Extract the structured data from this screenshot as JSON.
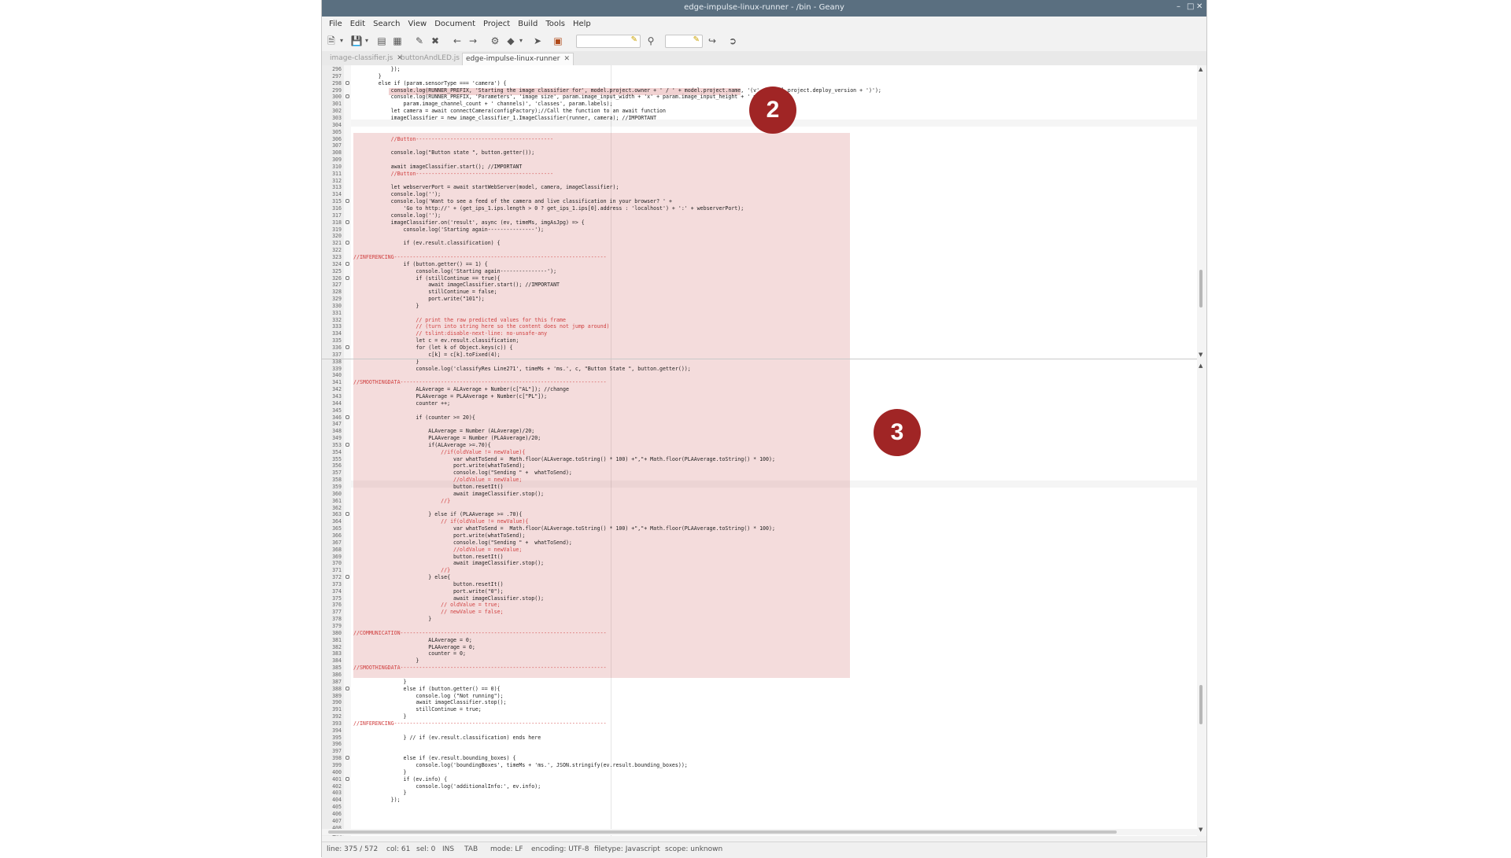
{
  "window": {
    "title": "edge-impulse-linux-runner - /bin - Geany"
  },
  "menu": [
    "File",
    "Edit",
    "Search",
    "View",
    "Document",
    "Project",
    "Build",
    "Tools",
    "Help"
  ],
  "tabs": [
    {
      "label": "image-classifier.js",
      "active": false
    },
    {
      "label": "buttonAndLED.js",
      "active": false
    },
    {
      "label": "edge-impulse-linux-runner",
      "active": true
    }
  ],
  "code_lines": [
    {
      "n": "296",
      "t": "            });"
    },
    {
      "n": "297",
      "t": "        }"
    },
    {
      "n": "298",
      "t": "        else if (param.sensorType === 'camera') {",
      "fold": true
    },
    {
      "n": "299",
      "t": "            console.log(RUNNER_PREFIX, 'Starting the image classifier for', model.project.owner + ' / ' + model.project.name, '(v' + model.project.deploy_version + ')');"
    },
    {
      "n": "300",
      "t": "            console.log(RUNNER_PREFIX, 'Parameters', 'image size', param.image_input_width + 'x' + param.image_input_height + ' px (' +",
      "fold": true
    },
    {
      "n": "301",
      "t": "                param.image_channel_count + ' channels)', 'classes', param.labels);"
    },
    {
      "n": "302",
      "t": "            let camera = await connectCamera(configFactory);//Call the function to an await function"
    },
    {
      "n": "303",
      "t": "            imageClassifier = new image_classifier_1.ImageClassifier(runner, camera); //IMPORTANT"
    },
    {
      "n": "304",
      "t": ""
    },
    {
      "n": "305",
      "t": ""
    },
    {
      "n": "306",
      "t": "            //Button--------------------------------------------",
      "c": true
    },
    {
      "n": "307",
      "t": ""
    },
    {
      "n": "308",
      "t": "            console.log(\"Button state \", button.getter());"
    },
    {
      "n": "309",
      "t": ""
    },
    {
      "n": "310",
      "t": "            await imageClassifier.start(); //IMPORTANT"
    },
    {
      "n": "311",
      "t": "            //Button--------------------------------------------",
      "c": true
    },
    {
      "n": "312",
      "t": ""
    },
    {
      "n": "313",
      "t": "            let webserverPort = await startWebServer(model, camera, imageClassifier);"
    },
    {
      "n": "314",
      "t": "            console.log('');"
    },
    {
      "n": "315",
      "t": "            console.log('Want to see a feed of the camera and live classification in your browser? ' +",
      "fold": true
    },
    {
      "n": "316",
      "t": "                'Go to http://' + (get_ips_1.ips.length > 0 ? get_ips_1.ips[0].address : 'localhost') + ':' + webserverPort);"
    },
    {
      "n": "317",
      "t": "            console.log('');"
    },
    {
      "n": "318",
      "t": "            imageClassifier.on('result', async (ev, timeMs, imgAsJpg) => {",
      "fold": true
    },
    {
      "n": "319",
      "t": "                console.log('Starting again---------------');"
    },
    {
      "n": "320",
      "t": ""
    },
    {
      "n": "321",
      "t": "                if (ev.result.classification) {",
      "fold": true
    },
    {
      "n": "322",
      "t": ""
    },
    {
      "n": "323",
      "t": "//INFERENCING--------------------------------------------------------------------",
      "c": true
    },
    {
      "n": "324",
      "t": "                if (button.getter() == 1) {",
      "fold": true
    },
    {
      "n": "325",
      "t": "                    console.log('Starting again---------------');"
    },
    {
      "n": "326",
      "t": "                    if (stillContinue == true){",
      "fold": true
    },
    {
      "n": "327",
      "t": "                        await imageClassifier.start(); //IMPORTANT"
    },
    {
      "n": "328",
      "t": "                        stillContinue = false;"
    },
    {
      "n": "329",
      "t": "                        port.write(\"101\");"
    },
    {
      "n": "330",
      "t": "                    }"
    },
    {
      "n": "331",
      "t": ""
    },
    {
      "n": "332",
      "t": "                    // print the raw predicted values for this frame",
      "c": true
    },
    {
      "n": "333",
      "t": "                    // (turn into string here so the content does not jump around)",
      "c": true
    },
    {
      "n": "334",
      "t": "                    // tslint:disable-next-line: no-unsafe-any",
      "c": true
    },
    {
      "n": "335",
      "t": "                    let c = ev.result.classification;"
    },
    {
      "n": "336",
      "t": "                    for (let k of Object.keys(c)) {",
      "fold": true
    },
    {
      "n": "337",
      "t": "                        c[k] = c[k].toFixed(4);"
    },
    {
      "n": "338",
      "t": "                    }"
    },
    {
      "n": "339",
      "t": "                    console.log('classifyRes Line271', timeMs + 'ms.', c, \"Button State \", button.getter());"
    },
    {
      "n": "340",
      "t": ""
    },
    {
      "n": "341",
      "t": "//SMOOTHINGDATA------------------------------------------------------------------",
      "c": true
    },
    {
      "n": "342",
      "t": "                    ALAverage = ALAverage + Number(c[\"AL\"]); //change"
    },
    {
      "n": "343",
      "t": "                    PLAAverage = PLAAverage + Number(c[\"PL\"]);"
    },
    {
      "n": "344",
      "t": "                    counter ++;"
    },
    {
      "n": "345",
      "t": ""
    },
    {
      "n": "346",
      "t": "                    if (counter >= 20){",
      "fold": true
    },
    {
      "n": "347",
      "t": ""
    },
    {
      "n": "348",
      "t": "                        ALAverage = Number (ALAverage)/20;"
    },
    {
      "n": "349",
      "t": "                        PLAAverage = Number (PLAAverage)/20;"
    },
    {
      "n": "353",
      "t": "                        if(ALAverage >=.70){",
      "fold": true
    },
    {
      "n": "354",
      "t": "                            //if(oldValue != newValue){",
      "c": true
    },
    {
      "n": "355",
      "t": "                                var whatToSend =  Math.floor(ALAverage.toString() * 100) +\",\"+ Math.floor(PLAAverage.toString() * 100);"
    },
    {
      "n": "356",
      "t": "                                port.write(whatToSend);"
    },
    {
      "n": "357",
      "t": "                                console.log(\"Sending \" +  whatToSend);"
    },
    {
      "n": "358",
      "t": "                                //oldValue = newValue;",
      "c": true
    },
    {
      "n": "359",
      "t": "                                button.resetIt()"
    },
    {
      "n": "360",
      "t": "                                await imageClassifier.stop();"
    },
    {
      "n": "361",
      "t": "                            //}",
      "c": true
    },
    {
      "n": "362",
      "t": ""
    },
    {
      "n": "363",
      "t": "                        } else if (PLAAverage >= .70){",
      "fold": true
    },
    {
      "n": "364",
      "t": "                            // if(oldValue != newValue){",
      "c": true
    },
    {
      "n": "365",
      "t": "                                var whatToSend =  Math.floor(ALAverage.toString() * 100) +\",\"+ Math.floor(PLAAverage.toString() * 100);"
    },
    {
      "n": "366",
      "t": "                                port.write(whatToSend);"
    },
    {
      "n": "367",
      "t": "                                console.log(\"Sending \" +  whatToSend);"
    },
    {
      "n": "368",
      "t": "                                //oldValue = newValue;",
      "c": true
    },
    {
      "n": "369",
      "t": "                                button.resetIt()"
    },
    {
      "n": "370",
      "t": "                                await imageClassifier.stop();"
    },
    {
      "n": "371",
      "t": "                            //}",
      "c": true
    },
    {
      "n": "372",
      "t": "                        } else{",
      "fold": true
    },
    {
      "n": "373",
      "t": "                                button.resetIt()"
    },
    {
      "n": "374",
      "t": "                                port.write(\"0\");"
    },
    {
      "n": "375",
      "t": "                                await imageClassifier.stop();"
    },
    {
      "n": "376",
      "t": "                            // oldValue = true;",
      "c": true
    },
    {
      "n": "377",
      "t": "                            // newValue = false;",
      "c": true
    },
    {
      "n": "378",
      "t": "                        }"
    },
    {
      "n": "379",
      "t": ""
    },
    {
      "n": "380",
      "t": "//COMMUNICATION------------------------------------------------------------------",
      "c": true
    },
    {
      "n": "381",
      "t": "                        ALAverage = 0;"
    },
    {
      "n": "382",
      "t": "                        PLAAverage = 0;"
    },
    {
      "n": "383",
      "t": "                        counter = 0;"
    },
    {
      "n": "384",
      "t": "                    }"
    },
    {
      "n": "385",
      "t": "//SMOOTHINGDATA------------------------------------------------------------------",
      "c": true
    },
    {
      "n": "386",
      "t": ""
    },
    {
      "n": "387",
      "t": "                }"
    },
    {
      "n": "388",
      "t": "                else if (button.getter() == 0){",
      "fold": true
    },
    {
      "n": "389",
      "t": "                    console.log (\"Not running\");"
    },
    {
      "n": "390",
      "t": "                    await imageClassifier.stop();"
    },
    {
      "n": "391",
      "t": "                    stillContinue = true;"
    },
    {
      "n": "392",
      "t": "                }"
    },
    {
      "n": "393",
      "t": "//INFERENCING--------------------------------------------------------------------",
      "c": true
    },
    {
      "n": "394",
      "t": ""
    },
    {
      "n": "395",
      "t": "                } // if (ev.result.classification) ends here"
    },
    {
      "n": "396",
      "t": ""
    },
    {
      "n": "397",
      "t": ""
    },
    {
      "n": "398",
      "t": "                else if (ev.result.bounding_boxes) {",
      "fold": true
    },
    {
      "n": "399",
      "t": "                    console.log('boundingBoxes', timeMs + 'ms.', JSON.stringify(ev.result.bounding_boxes));"
    },
    {
      "n": "400",
      "t": "                }"
    },
    {
      "n": "401",
      "t": "                if (ev.info) {",
      "fold": true
    },
    {
      "n": "402",
      "t": "                    console.log('additionalInfo:', ev.info);"
    },
    {
      "n": "403",
      "t": "                }"
    },
    {
      "n": "404",
      "t": "            });"
    },
    {
      "n": "405",
      "t": ""
    },
    {
      "n": "406",
      "t": ""
    },
    {
      "n": "407",
      "t": ""
    },
    {
      "n": "408",
      "t": ""
    },
    {
      "n": "409",
      "t": ""
    }
  ],
  "status": {
    "line": "line: 375 / 572",
    "col": "col: 61",
    "sel": "sel: 0",
    "ins": "INS",
    "tab": "TAB",
    "mode": "mode: LF",
    "encoding": "encoding: UTF-8",
    "filetype": "filetype: Javascript",
    "scope": "scope: unknown"
  },
  "badges": {
    "first": "2",
    "second": "3"
  },
  "colors": {
    "highlight": "#cd5f5f",
    "badge": "#a02525",
    "titlebar": "#5a6f80",
    "comment": "#d04040"
  }
}
